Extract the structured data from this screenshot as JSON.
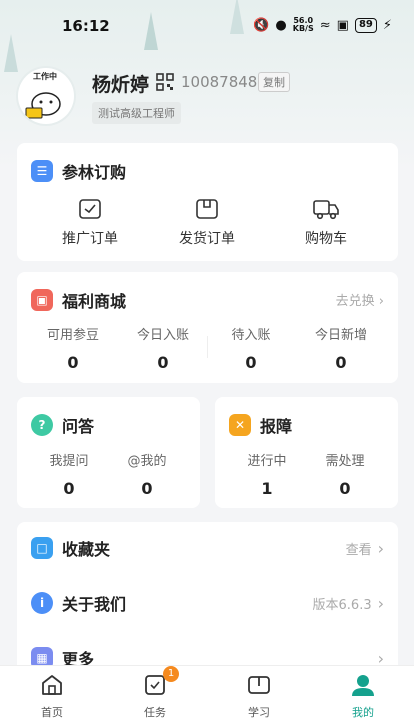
{
  "status_bar": {
    "time": "16:12",
    "net_speed_value": "56.0",
    "net_speed_unit": "KB/S",
    "battery": "89"
  },
  "profile": {
    "name": "杨炘婷",
    "user_id": "10087848",
    "copy_label": "复制",
    "job_title": "测试高级工程师",
    "avatar_badge": "工作中"
  },
  "shopping": {
    "title": "参林订购",
    "items": [
      {
        "label": "推广订单",
        "icon": "clipboard-check-icon"
      },
      {
        "label": "发货订单",
        "icon": "package-icon"
      },
      {
        "label": "购物车",
        "icon": "truck-icon"
      }
    ]
  },
  "welfare": {
    "title": "福利商城",
    "link": "去兑换",
    "stats": [
      {
        "label": "可用参豆",
        "value": "0"
      },
      {
        "label": "今日入账",
        "value": "0"
      },
      {
        "label": "待入账",
        "value": "0"
      },
      {
        "label": "今日新增",
        "value": "0"
      }
    ]
  },
  "qa": {
    "title": "问答",
    "stats": [
      {
        "label": "我提问",
        "value": "0"
      },
      {
        "label": "@我的",
        "value": "0"
      }
    ]
  },
  "repair": {
    "title": "报障",
    "stats": [
      {
        "label": "进行中",
        "value": "1"
      },
      {
        "label": "需处理",
        "value": "0"
      }
    ]
  },
  "menu": {
    "favorites": {
      "title": "收藏夹",
      "link": "查看"
    },
    "about": {
      "title": "关于我们",
      "link": "版本6.6.3"
    },
    "more": {
      "title": "更多"
    }
  },
  "tabs": [
    {
      "label": "首页",
      "active": false
    },
    {
      "label": "任务",
      "active": false,
      "badge": "1"
    },
    {
      "label": "学习",
      "active": false
    },
    {
      "label": "我的",
      "active": true
    }
  ],
  "colors": {
    "accent": "#15a18d",
    "blue": "#4c8ff7",
    "red": "#f0675b",
    "green": "#3ec9a3",
    "orange": "#f5a51f",
    "sky": "#3aa0f0"
  }
}
